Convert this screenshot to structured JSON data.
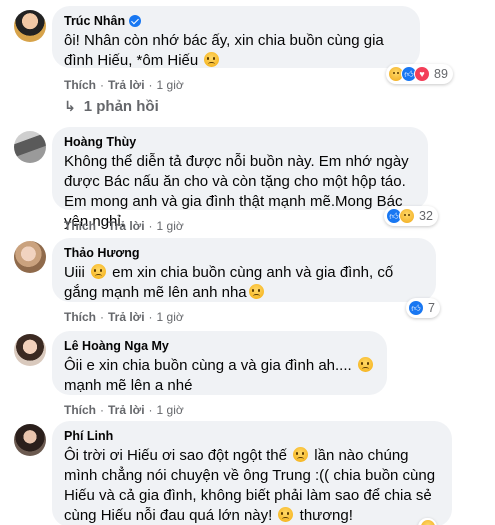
{
  "comments": [
    {
      "name": "Trúc Nhân",
      "verified": true,
      "text_parts": [
        "ôi! Nhân còn nhớ bác ấy, xin chia buồn cùng gia đình Hiếu, *ôm Hiếu "
      ],
      "like_label": "Thích",
      "reply_label": "Trả lời",
      "time": "1 giờ",
      "reaction_count": "89",
      "reaction_icons": [
        "sad-icon",
        "like-icon",
        "love-icon"
      ],
      "replies_label": "1 phản hồi"
    },
    {
      "name": "Hoàng Thùy",
      "text_parts": [
        "Không thể diễn tả được nỗi buồn này. Em nhớ ngày được Bác nấu ăn cho và còn tặng cho một hộp táo. Em mong anh và gia đình thật mạnh mẽ.Mong Bác yên nghỉ."
      ],
      "like_label": "Thích",
      "reply_label": "Trả lời",
      "time": "1 giờ",
      "reaction_count": "32",
      "reaction_icons": [
        "like-icon",
        "sad-icon"
      ]
    },
    {
      "name": "Thảo Hương",
      "text_parts": [
        "Uiii ",
        " em xin chia buồn cùng anh và gia đình, cố gắng mạnh mẽ lên anh nha"
      ],
      "like_label": "Thích",
      "reply_label": "Trả lời",
      "time": "1 giờ",
      "reaction_count": "7",
      "reaction_icons": [
        "like-icon"
      ]
    },
    {
      "name": "Lê Hoàng Nga My",
      "text_parts": [
        "Ôii e xin chia buồn cùng a và gia đình ah.... ",
        " mạnh mẽ lên a nhé"
      ],
      "like_label": "Thích",
      "reply_label": "Trả lời",
      "time": "1 giờ"
    },
    {
      "name": "Phí Linh",
      "text_parts": [
        "Ôi trời ơi Hiếu ơi sao đột ngột thế ",
        " lần nào chúng mình chẳng nói chuyện về ông Trung :(( chia buồn cùng Hiếu và cả gia đình, không biết phải làm sao để chia sẻ cùng Hiếu nỗi đau quá lớn này! ",
        " thương!"
      ],
      "reaction_icons": [
        "sad-icon"
      ]
    }
  ],
  "colors": {
    "bubble": "#f0f2f5",
    "meta": "#65676b",
    "like": "#1877f2",
    "love": "#f33e58",
    "sad": "#f7b928"
  }
}
